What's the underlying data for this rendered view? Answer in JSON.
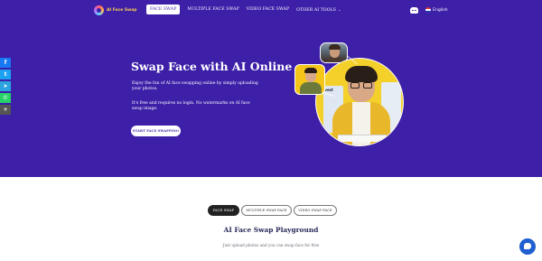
{
  "colors": {
    "hero_bg": "#3d1fa8",
    "logo_text": "#ffcf4a",
    "tab_active": "#222222",
    "chat_button": "#1f5fd0"
  },
  "header": {
    "logo_text": "AI Face Swap",
    "nav": [
      {
        "label": "FACE SWAP",
        "active": true
      },
      {
        "label": "MULTIPLE FACE SWAP",
        "active": false
      },
      {
        "label": "VIDEO FACE SWAP",
        "active": false
      },
      {
        "label": "OTHER AI TOOLS",
        "active": false,
        "icon": "chevron-down-icon"
      }
    ],
    "discord_icon": "discord-icon",
    "language": "English"
  },
  "social": [
    {
      "name": "facebook-icon",
      "glyph": "f",
      "color": "#1877f2"
    },
    {
      "name": "twitter-icon",
      "glyph": "t",
      "color": "#1da1f2"
    },
    {
      "name": "telegram-icon",
      "glyph": "➤",
      "color": "#2aa3df"
    },
    {
      "name": "whatsapp-icon",
      "glyph": "✆",
      "color": "#25d366"
    },
    {
      "name": "more-share-icon",
      "glyph": "+",
      "color": "#555555"
    }
  ],
  "hero": {
    "title": "Swap Face with AI Online",
    "description": "Enjoy the fun of AI face swapping online by simply uploading your photos.",
    "description2": "It's free and requires no login. No watermarks on AI face swap image.",
    "cta": "START FACE SWAPPING"
  },
  "hero_image": {
    "screen_text": "Invest"
  },
  "tabs": [
    {
      "label": "FACE SWAP",
      "active": true
    },
    {
      "label": "MULTIPLE SWAP FACE",
      "active": false
    },
    {
      "label": "VIDEO SWAP FACE",
      "active": false
    }
  ],
  "playground": {
    "title": "AI Face Swap Playground",
    "subtitle": "Just upload photos and you can swap face for free"
  }
}
